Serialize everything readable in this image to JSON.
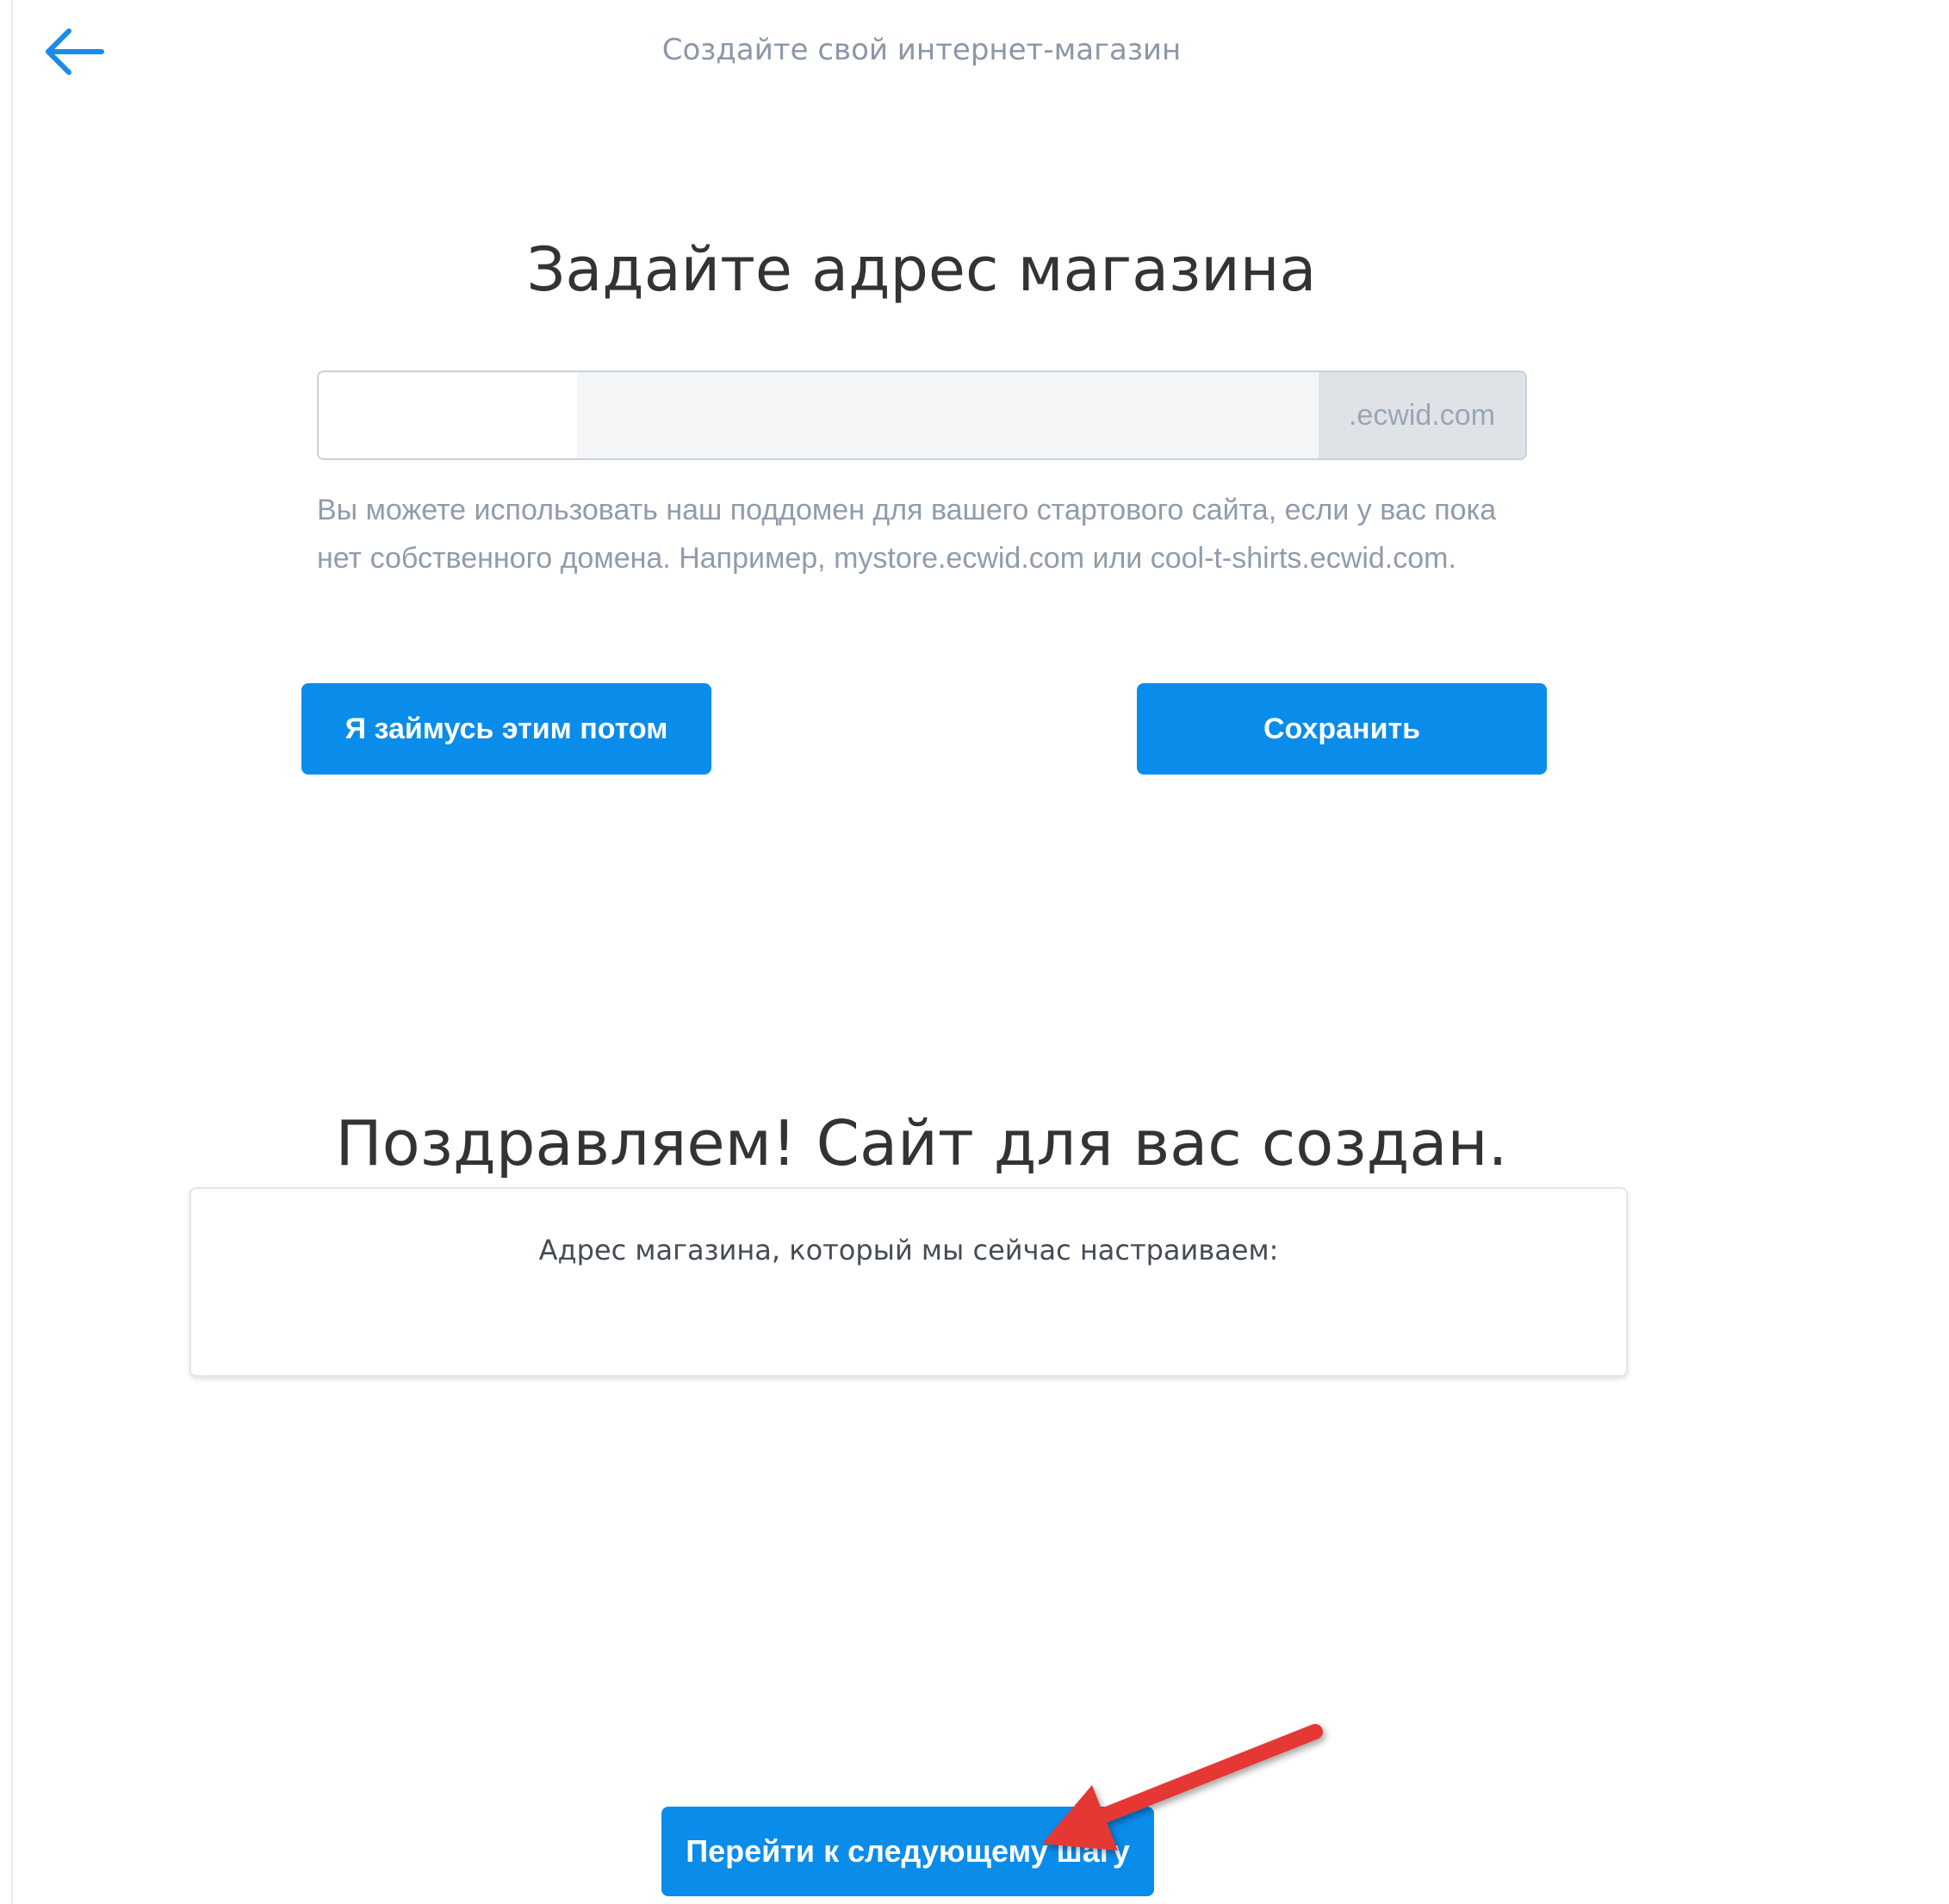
{
  "header": {
    "back_icon": "arrow-left-icon",
    "title": "Создайте свой интернет-магазин"
  },
  "address_section": {
    "heading": "Задайте адрес магазина",
    "input_value": "",
    "domain_suffix": ".ecwid.com",
    "hint": "Вы можете использовать наш поддомен для вашего стартового сайта, если у вас пока нет собственного домена. Например, mystore.ecwid.com или cool-t-shirts.ecwid.com.",
    "later_button": "Я займусь этим потом",
    "save_button": "Сохранить"
  },
  "congrats_section": {
    "heading": "Поздравляем! Сайт для вас создан.",
    "card_label": "Адрес магазина, который мы сейчас настраиваем:",
    "card_value": ""
  },
  "footer": {
    "next_button": "Перейти к следующему шагу"
  },
  "annotation": {
    "arrow_icon": "red-pointer-arrow-icon",
    "arrow_color": "#e53935"
  },
  "colors": {
    "accent": "#0a8cea",
    "muted_text": "#8f9cab"
  }
}
